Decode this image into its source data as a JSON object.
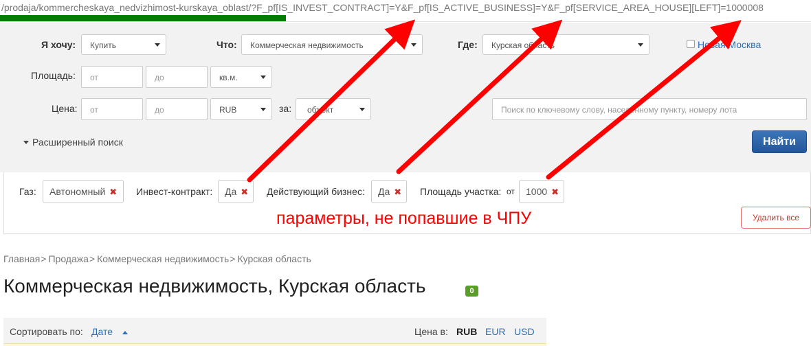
{
  "url": {
    "text": "/prodaja/kommercheskaya_nedvizhimost-kurskaya_oblast/?F_pf[IS_INVEST_CONTRACT]=Y&F_pf[IS_ACTIVE_BUSINESS]=Y&F_pf[SERVICE_AREA_HOUSE][LEFT]=1000008"
  },
  "search": {
    "want_label": "Я хочу:",
    "want_value": "Купить",
    "what_label": "Что:",
    "what_value": "Коммерческая недвижимость",
    "where_label": "Где:",
    "where_value": "Курская область",
    "new_moscow_label": "Новая Москва",
    "area_label": "Площадь:",
    "area_from_placeholder": "от",
    "area_to_placeholder": "до",
    "area_unit": "кв.м.",
    "price_label": "Цена:",
    "price_from_placeholder": "от",
    "price_to_placeholder": "до",
    "currency": "RUB",
    "per_label": "за:",
    "per_value": "объект",
    "keyword_placeholder": "Поиск по ключевому слову, населенному пункту, номеру лота",
    "advanced_label": "Расширенный поиск",
    "find_button": "Найти"
  },
  "filters": {
    "gas_label": "Газ:",
    "gas_value": "Автономный",
    "invest_label": "Инвест-контракт:",
    "invest_value": "Да",
    "business_label": "Действующий бизнес:",
    "business_value": "Да",
    "plot_label": "Площадь участка:",
    "plot_from": "от",
    "plot_value": "1000",
    "remove_glyph": "✖",
    "delete_all": "Удалить все",
    "annotation": "параметры, не попавшие в ЧПУ"
  },
  "breadcrumb": {
    "items": [
      "Главная",
      "Продажа",
      "Коммерческая недвижимость",
      "Курская область"
    ],
    "separator": ">"
  },
  "page": {
    "title": "Коммерческая недвижимость, Курская область",
    "count": "0"
  },
  "sort": {
    "label": "Сортировать по:",
    "value": "Дате",
    "price_in_label": "Цена в:",
    "currencies": [
      "RUB",
      "EUR",
      "USD"
    ],
    "active_currency": "RUB"
  },
  "colors": {
    "accent_blue": "#2a6ebb",
    "progress_green": "#007c00",
    "annotation_red": "#ff0000",
    "remove_red": "#c9302c",
    "badge_green": "#5a9e2a"
  }
}
